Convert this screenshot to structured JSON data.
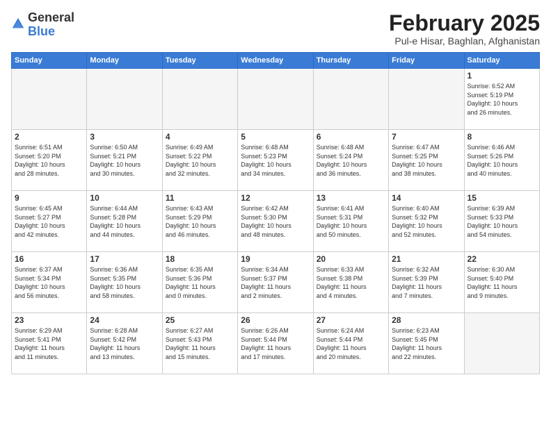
{
  "header": {
    "logo_general": "General",
    "logo_blue": "Blue",
    "month_title": "February 2025",
    "location": "Pul-e Hisar, Baghlan, Afghanistan"
  },
  "weekdays": [
    "Sunday",
    "Monday",
    "Tuesday",
    "Wednesday",
    "Thursday",
    "Friday",
    "Saturday"
  ],
  "weeks": [
    [
      {
        "day": "",
        "info": ""
      },
      {
        "day": "",
        "info": ""
      },
      {
        "day": "",
        "info": ""
      },
      {
        "day": "",
        "info": ""
      },
      {
        "day": "",
        "info": ""
      },
      {
        "day": "",
        "info": ""
      },
      {
        "day": "1",
        "info": "Sunrise: 6:52 AM\nSunset: 5:19 PM\nDaylight: 10 hours\nand 26 minutes."
      }
    ],
    [
      {
        "day": "2",
        "info": "Sunrise: 6:51 AM\nSunset: 5:20 PM\nDaylight: 10 hours\nand 28 minutes."
      },
      {
        "day": "3",
        "info": "Sunrise: 6:50 AM\nSunset: 5:21 PM\nDaylight: 10 hours\nand 30 minutes."
      },
      {
        "day": "4",
        "info": "Sunrise: 6:49 AM\nSunset: 5:22 PM\nDaylight: 10 hours\nand 32 minutes."
      },
      {
        "day": "5",
        "info": "Sunrise: 6:48 AM\nSunset: 5:23 PM\nDaylight: 10 hours\nand 34 minutes."
      },
      {
        "day": "6",
        "info": "Sunrise: 6:48 AM\nSunset: 5:24 PM\nDaylight: 10 hours\nand 36 minutes."
      },
      {
        "day": "7",
        "info": "Sunrise: 6:47 AM\nSunset: 5:25 PM\nDaylight: 10 hours\nand 38 minutes."
      },
      {
        "day": "8",
        "info": "Sunrise: 6:46 AM\nSunset: 5:26 PM\nDaylight: 10 hours\nand 40 minutes."
      }
    ],
    [
      {
        "day": "9",
        "info": "Sunrise: 6:45 AM\nSunset: 5:27 PM\nDaylight: 10 hours\nand 42 minutes."
      },
      {
        "day": "10",
        "info": "Sunrise: 6:44 AM\nSunset: 5:28 PM\nDaylight: 10 hours\nand 44 minutes."
      },
      {
        "day": "11",
        "info": "Sunrise: 6:43 AM\nSunset: 5:29 PM\nDaylight: 10 hours\nand 46 minutes."
      },
      {
        "day": "12",
        "info": "Sunrise: 6:42 AM\nSunset: 5:30 PM\nDaylight: 10 hours\nand 48 minutes."
      },
      {
        "day": "13",
        "info": "Sunrise: 6:41 AM\nSunset: 5:31 PM\nDaylight: 10 hours\nand 50 minutes."
      },
      {
        "day": "14",
        "info": "Sunrise: 6:40 AM\nSunset: 5:32 PM\nDaylight: 10 hours\nand 52 minutes."
      },
      {
        "day": "15",
        "info": "Sunrise: 6:39 AM\nSunset: 5:33 PM\nDaylight: 10 hours\nand 54 minutes."
      }
    ],
    [
      {
        "day": "16",
        "info": "Sunrise: 6:37 AM\nSunset: 5:34 PM\nDaylight: 10 hours\nand 56 minutes."
      },
      {
        "day": "17",
        "info": "Sunrise: 6:36 AM\nSunset: 5:35 PM\nDaylight: 10 hours\nand 58 minutes."
      },
      {
        "day": "18",
        "info": "Sunrise: 6:35 AM\nSunset: 5:36 PM\nDaylight: 11 hours\nand 0 minutes."
      },
      {
        "day": "19",
        "info": "Sunrise: 6:34 AM\nSunset: 5:37 PM\nDaylight: 11 hours\nand 2 minutes."
      },
      {
        "day": "20",
        "info": "Sunrise: 6:33 AM\nSunset: 5:38 PM\nDaylight: 11 hours\nand 4 minutes."
      },
      {
        "day": "21",
        "info": "Sunrise: 6:32 AM\nSunset: 5:39 PM\nDaylight: 11 hours\nand 7 minutes."
      },
      {
        "day": "22",
        "info": "Sunrise: 6:30 AM\nSunset: 5:40 PM\nDaylight: 11 hours\nand 9 minutes."
      }
    ],
    [
      {
        "day": "23",
        "info": "Sunrise: 6:29 AM\nSunset: 5:41 PM\nDaylight: 11 hours\nand 11 minutes."
      },
      {
        "day": "24",
        "info": "Sunrise: 6:28 AM\nSunset: 5:42 PM\nDaylight: 11 hours\nand 13 minutes."
      },
      {
        "day": "25",
        "info": "Sunrise: 6:27 AM\nSunset: 5:43 PM\nDaylight: 11 hours\nand 15 minutes."
      },
      {
        "day": "26",
        "info": "Sunrise: 6:26 AM\nSunset: 5:44 PM\nDaylight: 11 hours\nand 17 minutes."
      },
      {
        "day": "27",
        "info": "Sunrise: 6:24 AM\nSunset: 5:44 PM\nDaylight: 11 hours\nand 20 minutes."
      },
      {
        "day": "28",
        "info": "Sunrise: 6:23 AM\nSunset: 5:45 PM\nDaylight: 11 hours\nand 22 minutes."
      },
      {
        "day": "",
        "info": ""
      }
    ]
  ]
}
